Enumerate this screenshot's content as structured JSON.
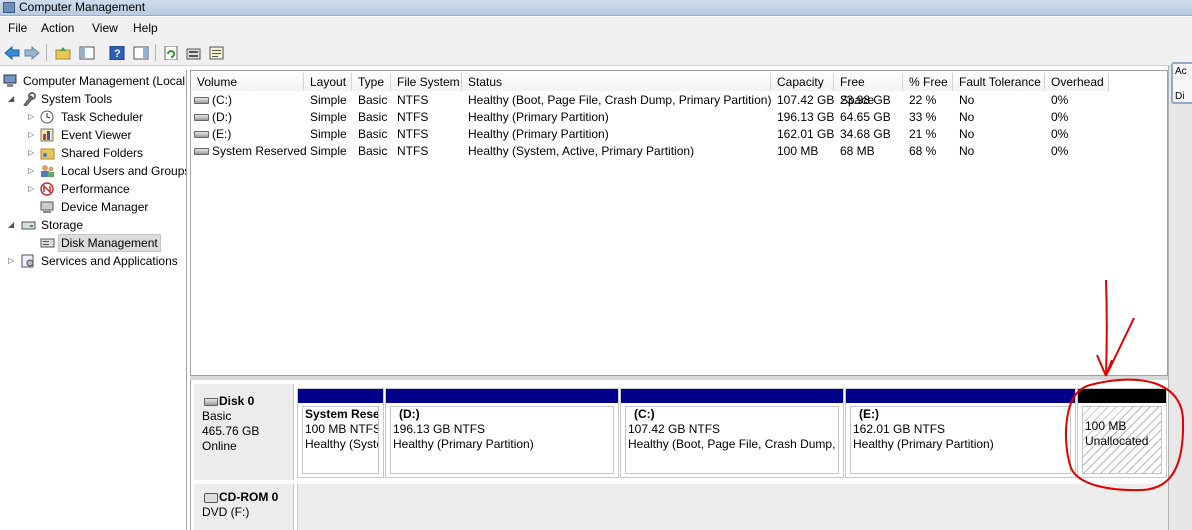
{
  "window": {
    "title": "Computer Management"
  },
  "menu": [
    "File",
    "Action",
    "View",
    "Help"
  ],
  "toolbar": {
    "icons": [
      "back-arrow-icon",
      "forward-arrow-icon",
      "up-folder-icon",
      "show-hide-tree-icon",
      "help-icon",
      "action-pane-icon",
      "refresh-icon",
      "properties-icon",
      "export-icon"
    ]
  },
  "tree": {
    "root": "Computer Management (Local",
    "system_tools": "System Tools",
    "task_scheduler": "Task Scheduler",
    "event_viewer": "Event Viewer",
    "shared_folders": "Shared Folders",
    "local_users": "Local Users and Groups",
    "performance": "Performance",
    "device_manager": "Device Manager",
    "storage": "Storage",
    "disk_management": "Disk Management",
    "services": "Services and Applications"
  },
  "volumes": {
    "columns": [
      "Volume",
      "Layout",
      "Type",
      "File System",
      "Status",
      "Capacity",
      "Free Space",
      "% Free",
      "Fault Tolerance",
      "Overhead"
    ],
    "rows": [
      [
        "(C:)",
        "Simple",
        "Basic",
        "NTFS",
        "Healthy (Boot, Page File, Crash Dump, Primary Partition)",
        "107.42 GB",
        "23.98 GB",
        "22 %",
        "No",
        "0%"
      ],
      [
        "(D:)",
        "Simple",
        "Basic",
        "NTFS",
        "Healthy (Primary Partition)",
        "196.13 GB",
        "64.65 GB",
        "33 %",
        "No",
        "0%"
      ],
      [
        "(E:)",
        "Simple",
        "Basic",
        "NTFS",
        "Healthy (Primary Partition)",
        "162.01 GB",
        "34.68 GB",
        "21 %",
        "No",
        "0%"
      ],
      [
        "System Reserved",
        "Simple",
        "Basic",
        "NTFS",
        "Healthy (System, Active, Primary Partition)",
        "100 MB",
        "68 MB",
        "68 %",
        "No",
        "0%"
      ]
    ]
  },
  "disk0": {
    "name": "Disk 0",
    "type": "Basic",
    "size": "465.76 GB",
    "state": "Online",
    "partitions": [
      {
        "name": "System Reser",
        "size": "100 MB NTFS",
        "status": "Healthy (Syste"
      },
      {
        "name": "(D:)",
        "size": "196.13 GB NTFS",
        "status": "Healthy (Primary Partition)"
      },
      {
        "name": "(C:)",
        "size": "107.42 GB NTFS",
        "status": "Healthy (Boot, Page File, Crash Dump, P"
      },
      {
        "name": "(E:)",
        "size": "162.01 GB NTFS",
        "status": "Healthy (Primary Partition)"
      }
    ],
    "unallocated": {
      "size": "100 MB",
      "label": "Unallocated"
    }
  },
  "cdrom": {
    "name": "CD-ROM 0",
    "drive": "DVD (F:)"
  },
  "actions_pane": {
    "label": "Ac",
    "sub": "Di"
  },
  "colors": {
    "partition_bar": "#00008b",
    "unallocated_bar": "#000000",
    "annotation": "#e00000"
  }
}
